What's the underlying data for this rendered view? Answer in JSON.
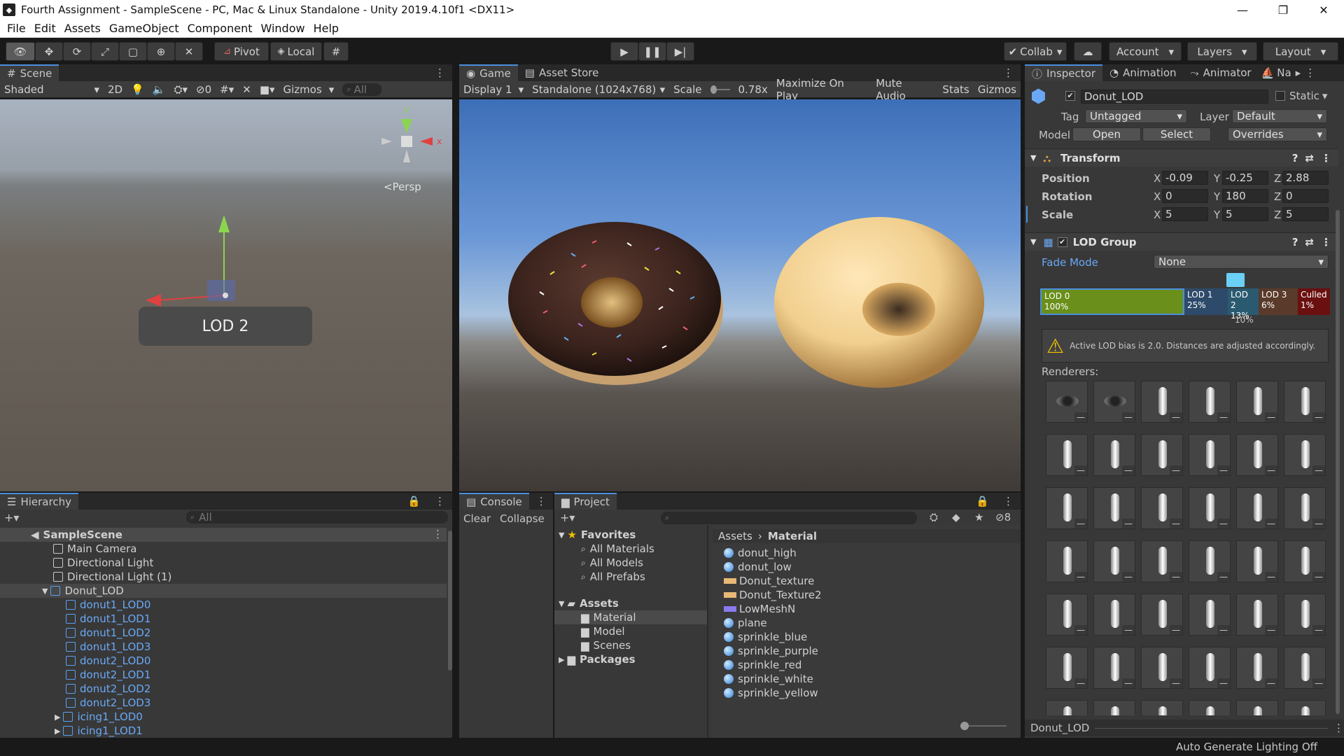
{
  "window": {
    "title": "Fourth Assignment - SampleScene - PC, Mac & Linux Standalone - Unity 2019.4.10f1 <DX11>",
    "icon": "unity-icon"
  },
  "menu": [
    "File",
    "Edit",
    "Assets",
    "GameObject",
    "Component",
    "Window",
    "Help"
  ],
  "toolbar": {
    "pivot": "Pivot",
    "local": "Local",
    "collab": "Collab",
    "account": "Account",
    "layers": "Layers",
    "layout": "Layout"
  },
  "scene": {
    "tab": "Scene",
    "shading": "Shaded",
    "mode2d": "2D",
    "hidden_count": "0",
    "gizmos": "Gizmos",
    "search_placeholder": "All",
    "persp": "<Persp",
    "lod_label": "LOD 2",
    "axis_y": "y",
    "axis_x": "x"
  },
  "game": {
    "tab_game": "Game",
    "tab_store": "Asset Store",
    "display": "Display 1",
    "resolution": "Standalone (1024x768)",
    "scale_label": "Scale",
    "scale_value": "0.78x",
    "maximize": "Maximize On Play",
    "mute": "Mute Audio",
    "stats": "Stats",
    "gizmos": "Gizmos"
  },
  "hierarchy": {
    "tab": "Hierarchy",
    "search_placeholder": "All",
    "scene_name": "SampleScene",
    "items": [
      {
        "label": "Main Camera",
        "indent": 1,
        "prefab": false
      },
      {
        "label": "Directional Light",
        "indent": 1,
        "prefab": false
      },
      {
        "label": "Directional Light (1)",
        "indent": 1,
        "prefab": false
      },
      {
        "label": "Donut_LOD",
        "indent": 1,
        "prefab": true,
        "expanded": true
      },
      {
        "label": "donut1_LOD0",
        "indent": 2,
        "prefab": true
      },
      {
        "label": "donut1_LOD1",
        "indent": 2,
        "prefab": true
      },
      {
        "label": "donut1_LOD2",
        "indent": 2,
        "prefab": true
      },
      {
        "label": "donut1_LOD3",
        "indent": 2,
        "prefab": true
      },
      {
        "label": "donut2_LOD0",
        "indent": 2,
        "prefab": true
      },
      {
        "label": "donut2_LOD1",
        "indent": 2,
        "prefab": true
      },
      {
        "label": "donut2_LOD2",
        "indent": 2,
        "prefab": true
      },
      {
        "label": "donut2_LOD3",
        "indent": 2,
        "prefab": true
      },
      {
        "label": "icing1_LOD0",
        "indent": 2,
        "prefab": true,
        "collapsed": true
      },
      {
        "label": "icing1_LOD1",
        "indent": 2,
        "prefab": true,
        "collapsed": true
      }
    ]
  },
  "console": {
    "tab": "Console",
    "clear": "Clear",
    "collapse": "Collapse"
  },
  "project": {
    "tab": "Project",
    "hidden_count": "8",
    "favorites": {
      "label": "Favorites",
      "items": [
        "All Materials",
        "All Models",
        "All Prefabs"
      ]
    },
    "assets": {
      "label": "Assets",
      "items": [
        "Material",
        "Model",
        "Scenes"
      ]
    },
    "packages": "Packages",
    "breadcrumb": {
      "root": "Assets",
      "current": "Material"
    },
    "files": [
      {
        "name": "donut_high",
        "type": "material"
      },
      {
        "name": "donut_low",
        "type": "material"
      },
      {
        "name": "Donut_texture",
        "type": "texture"
      },
      {
        "name": "Donut_Texture2",
        "type": "texture"
      },
      {
        "name": "LowMeshN",
        "type": "normal"
      },
      {
        "name": "plane",
        "type": "material"
      },
      {
        "name": "sprinkle_blue",
        "type": "material"
      },
      {
        "name": "sprinkle_purple",
        "type": "material"
      },
      {
        "name": "sprinkle_red",
        "type": "material"
      },
      {
        "name": "sprinkle_white",
        "type": "material"
      },
      {
        "name": "sprinkle_yellow",
        "type": "material"
      }
    ]
  },
  "inspector": {
    "tab_inspector": "Inspector",
    "tab_animation": "Animation",
    "tab_animator": "Animator",
    "tab_na": "Na",
    "object_name": "Donut_LOD",
    "static": "Static",
    "tag_label": "Tag",
    "tag_value": "Untagged",
    "layer_label": "Layer",
    "layer_value": "Default",
    "model_label": "Model",
    "open": "Open",
    "select": "Select",
    "overrides": "Overrides",
    "transform": {
      "title": "Transform",
      "position": {
        "label": "Position",
        "x": "-0.09",
        "y": "-0.25",
        "z": "2.88"
      },
      "rotation": {
        "label": "Rotation",
        "x": "0",
        "y": "180",
        "z": "0"
      },
      "scale": {
        "label": "Scale",
        "x": "5",
        "y": "5",
        "z": "5"
      }
    },
    "lod_group": {
      "title": "LOD Group",
      "fade_mode_label": "Fade Mode",
      "fade_mode_value": "None",
      "levels": [
        {
          "name": "LOD 0",
          "pct": "100%",
          "color": "#6a8f1a"
        },
        {
          "name": "LOD 1",
          "pct": "25%",
          "color": "#2e4a6a"
        },
        {
          "name": "LOD 2",
          "pct": "13%",
          "color": "#2a5a70"
        },
        {
          "name": "LOD 3",
          "pct": "6%",
          "color": "#5a3a2a"
        },
        {
          "name": "Culled",
          "pct": "1%",
          "color": "#6a1010"
        }
      ],
      "marker": "10%",
      "warning": "Active LOD bias is 2.0. Distances are adjusted accordingly.",
      "renderers_label": "Renderers:"
    },
    "footer": "Donut_LOD"
  },
  "status": "Auto Generate Lighting Off",
  "colors": {
    "accent": "#4a8fe0",
    "prefab_blue": "#6aa8f5",
    "lod0": "#6a8f1a",
    "culled": "#6a1010",
    "warning": "#f0c000"
  }
}
